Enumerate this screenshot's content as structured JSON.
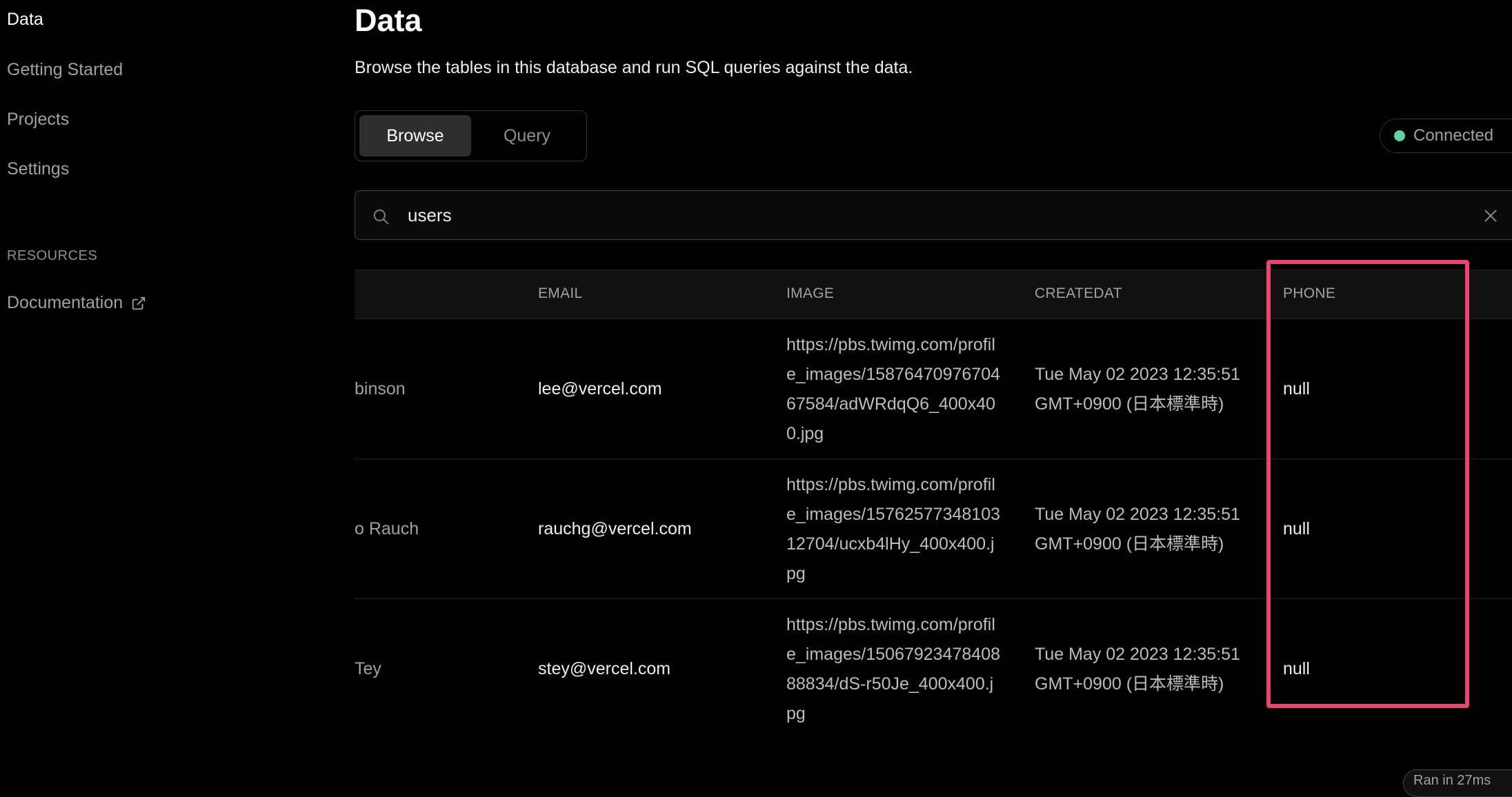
{
  "sidebar": {
    "items": [
      {
        "label": "Data",
        "active": true
      },
      {
        "label": "Getting Started"
      },
      {
        "label": "Projects"
      },
      {
        "label": "Settings"
      }
    ],
    "section_label": "RESOURCES",
    "resources": [
      {
        "label": "Documentation",
        "icon": "external-link-icon"
      }
    ]
  },
  "main": {
    "title": "Data",
    "description": "Browse the tables in this database and run SQL queries against the data.",
    "tabs": [
      {
        "label": "Browse",
        "selected": true
      },
      {
        "label": "Query",
        "selected": false
      }
    ],
    "status": {
      "label": "Connected",
      "color": "#5fd3a5"
    },
    "search": {
      "value": "users",
      "icon": "search-icon",
      "clear_icon": "close-icon"
    },
    "table": {
      "columns": [
        "",
        "EMAIL",
        "IMAGE",
        "CREATEDAT",
        "PHONE"
      ],
      "rows": [
        {
          "name": "binson",
          "email": "lee@vercel.com",
          "image": "https://pbs.twimg.com/profile_images/1587647097670467584/adWRdqQ6_400x400.jpg",
          "createdat": "Tue May 02 2023 12:35:51 GMT+0900 (日本標準時)",
          "phone": "null"
        },
        {
          "name": "o Rauch",
          "email": "rauchg@vercel.com",
          "image": "https://pbs.twimg.com/profile_images/1576257734810312704/ucxb4lHy_400x400.jpg",
          "createdat": "Tue May 02 2023 12:35:51 GMT+0900 (日本標準時)",
          "phone": "null"
        },
        {
          "name": "Tey",
          "email": "stey@vercel.com",
          "image": "https://pbs.twimg.com/profile_images/1506792347840888834/dS-r50Je_400x400.jpg",
          "createdat": "Tue May 02 2023 12:35:51 GMT+0900 (日本標準時)",
          "phone": "null"
        }
      ]
    },
    "highlight_color": "#e8466e",
    "toast": "Ran in 27ms"
  }
}
